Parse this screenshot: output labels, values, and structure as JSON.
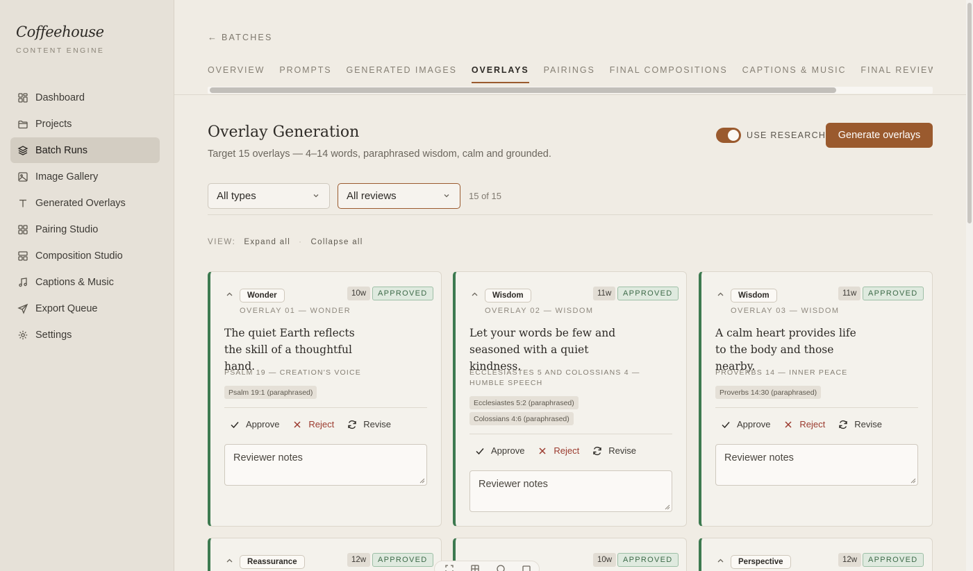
{
  "brand": {
    "name": "Coffeehouse",
    "subtitle": "CONTENT ENGINE"
  },
  "sidebar": {
    "items": [
      {
        "label": "Dashboard",
        "icon": "grid-icon",
        "active": false
      },
      {
        "label": "Projects",
        "icon": "folder-icon",
        "active": false
      },
      {
        "label": "Batch Runs",
        "icon": "layers-icon",
        "active": true
      },
      {
        "label": "Image Gallery",
        "icon": "image-icon",
        "active": false
      },
      {
        "label": "Generated Overlays",
        "icon": "type-icon",
        "active": false
      },
      {
        "label": "Pairing Studio",
        "icon": "pairing-icon",
        "active": false
      },
      {
        "label": "Composition Studio",
        "icon": "layout-icon",
        "active": false
      },
      {
        "label": "Captions & Music",
        "icon": "music-icon",
        "active": false
      },
      {
        "label": "Export Queue",
        "icon": "send-icon",
        "active": false
      },
      {
        "label": "Settings",
        "icon": "gear-icon",
        "active": false
      }
    ]
  },
  "header": {
    "back_label": "BATCHES",
    "tabs": [
      {
        "label": "OVERVIEW",
        "active": false
      },
      {
        "label": "PROMPTS",
        "active": false
      },
      {
        "label": "GENERATED IMAGES",
        "active": false
      },
      {
        "label": "OVERLAYS",
        "active": true
      },
      {
        "label": "PAIRINGS",
        "active": false
      },
      {
        "label": "FINAL COMPOSITIONS",
        "active": false
      },
      {
        "label": "CAPTIONS & MUSIC",
        "active": false
      },
      {
        "label": "FINAL REVIEW",
        "active": false
      }
    ]
  },
  "page": {
    "title": "Overlay Generation",
    "subtitle": "Target 15 overlays — 4–14 words, paraphrased wisdom, calm and grounded.",
    "research_label": "USE RESEARCH",
    "research_on": true,
    "generate_label": "Generate overlays"
  },
  "filters": {
    "type_value": "All types",
    "review_value": "All reviews",
    "count": "15 of 15",
    "view_label": "VIEW:",
    "expand_label": "Expand all",
    "dot": "·",
    "collapse_label": "Collapse all"
  },
  "actions": {
    "approve": "Approve",
    "reject": "Reject",
    "revise": "Revise",
    "notes_placeholder": "Reviewer notes"
  },
  "cards": [
    {
      "type": "Wonder",
      "words": "10w",
      "status": "APPROVED",
      "label": "OVERLAY 01 — WONDER",
      "quote": "The quiet Earth reflects the skill of a thoughtful hand.",
      "source": "PSALM 19 — CREATION'S VOICE",
      "refs": [
        "Psalm 19:1 (paraphrased)"
      ]
    },
    {
      "type": "Wisdom",
      "words": "11w",
      "status": "APPROVED",
      "label": "OVERLAY 02 — WISDOM",
      "quote": "Let your words be few and seasoned with a quiet kindness.",
      "source": "ECCLESIASTES 5 AND COLOSSIANS 4 — HUMBLE SPEECH",
      "refs": [
        "Ecclesiastes 5:2 (paraphrased)",
        "Colossians 4:6 (paraphrased)"
      ]
    },
    {
      "type": "Wisdom",
      "words": "11w",
      "status": "APPROVED",
      "label": "OVERLAY 03 — WISDOM",
      "quote": "A calm heart provides life to the body and those nearby.",
      "source": "PROVERBS 14 — INNER PEACE",
      "refs": [
        "Proverbs 14:30 (paraphrased)"
      ]
    }
  ],
  "cards_row2": [
    {
      "type": "Reassurance",
      "words": "12w",
      "status": "APPROVED"
    },
    {
      "type": "",
      "words": "10w",
      "status": "APPROVED"
    },
    {
      "type": "Perspective",
      "words": "12w",
      "status": "APPROVED"
    }
  ],
  "colors": {
    "accent": "#9a5a2e",
    "approved_border": "#3d7a50",
    "reject": "#9b3a2e",
    "background": "#f0ece4",
    "sidebar": "#e6e1d8"
  }
}
